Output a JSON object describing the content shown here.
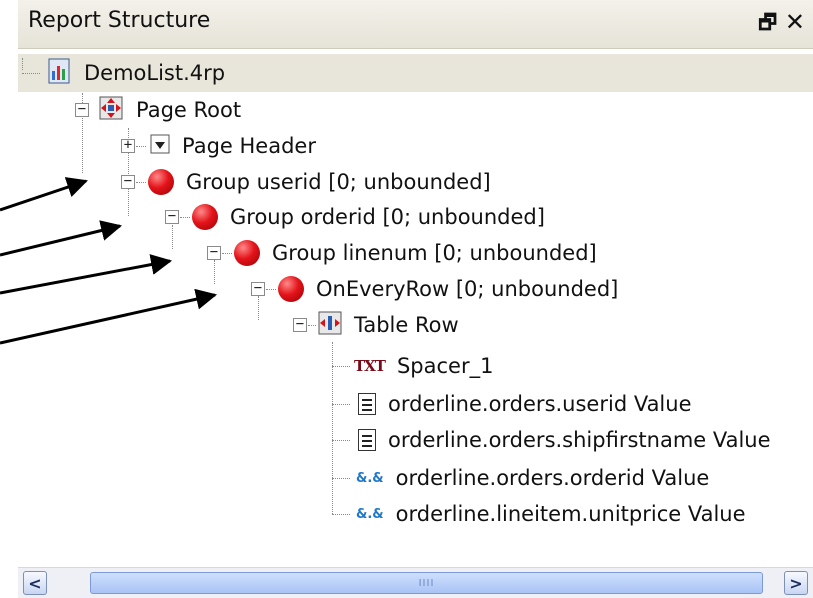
{
  "panel": {
    "title": "Report Structure",
    "dock_glyph": "🗗",
    "close_glyph": "✕"
  },
  "tree": {
    "root": {
      "label": "DemoList.4rp",
      "icon": "report-file-icon"
    },
    "page_root": {
      "label": "Page Root",
      "icon": "page-root-icon",
      "expander": "⊟"
    },
    "page_header": {
      "label": "Page Header",
      "icon": "page-header-icon",
      "expander": "⊞"
    },
    "group_userid": {
      "label": "Group userid [0; unbounded]",
      "icon": "trigger-ball-icon"
    },
    "group_orderid": {
      "label": "Group orderid [0; unbounded]",
      "icon": "trigger-ball-icon"
    },
    "group_linenum": {
      "label": "Group linenum [0; unbounded]",
      "icon": "trigger-ball-icon"
    },
    "on_every_row": {
      "label": "OnEveryRow [0; unbounded]",
      "icon": "trigger-ball-icon"
    },
    "table_row": {
      "label": "Table Row",
      "icon": "table-row-icon"
    },
    "spacer": {
      "label": "Spacer_1",
      "icon": "text-box-icon",
      "icon_text": "TXT"
    },
    "field_userid": {
      "label": "orderline.orders.userid Value",
      "icon": "document-icon"
    },
    "field_shipfirstname": {
      "label": "orderline.orders.shipfirstname Value",
      "icon": "document-icon"
    },
    "field_orderid": {
      "label": "orderline.orders.orderid Value",
      "icon": "numeric-value-icon",
      "icon_text": "&.&"
    },
    "field_unitprice": {
      "label": "orderline.lineitem.unitprice Value",
      "icon": "numeric-value-icon",
      "icon_text": "&.&"
    }
  },
  "scrollbar": {
    "left_arrow": "<",
    "right_arrow": ">",
    "grip": "IIII"
  },
  "colors": {
    "trigger_ball": "#e3141a",
    "annotation_arrow": "#000000",
    "scroll_thumb": "#a9c3f5"
  }
}
